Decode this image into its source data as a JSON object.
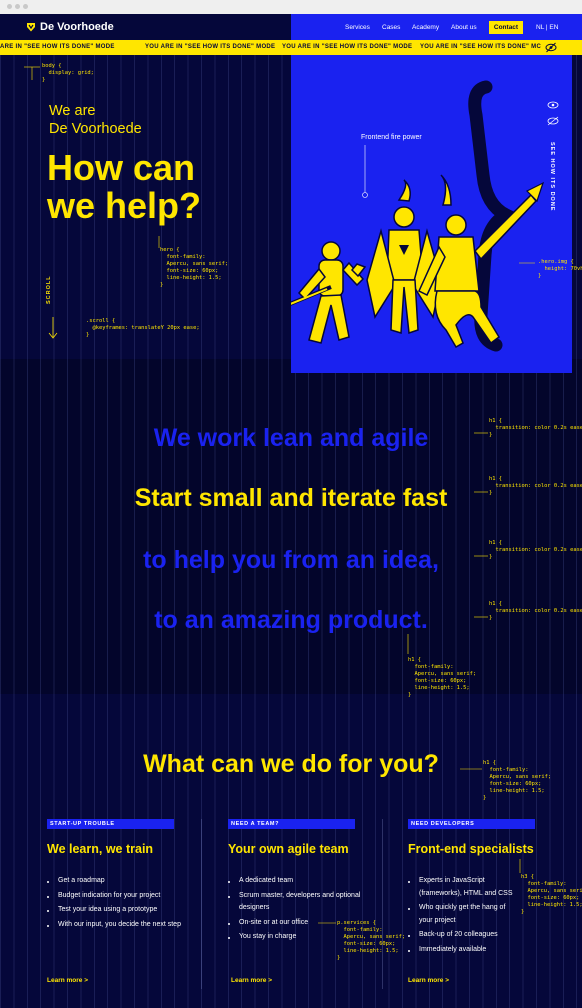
{
  "brand": {
    "name": "De Voorhoede",
    "accent_yellow": "#ffe600",
    "accent_blue": "#1a22f0",
    "background": "#05073a"
  },
  "nav": {
    "links": [
      "Services",
      "Cases",
      "Academy",
      "About us"
    ],
    "contact_label": "Contact",
    "language_label": "NL | EN"
  },
  "marquee": {
    "text": "YOU ARE IN \"SEE HOW ITS DONE\" MODE",
    "first_text": "ARE IN \"SEE HOW ITS DONE\" MODE",
    "last_text": "YOU ARE IN \"SEE HOW ITS DONE\" MC"
  },
  "hero": {
    "subtitle": "We are\nDe Voorhoede",
    "title": "How can\nwe help?",
    "scroll_label": "SCROLL",
    "side_label": "SEE HOW ITS DONE",
    "illustration_caption": "Frontend fire power"
  },
  "code_notes": {
    "body": "body {\n  display: grid;\n}",
    "hero": "hero {\n  font-family:\n  Apercu, sans serif;\n  font-size: 60px;\n  line-height: 1.5;\n}",
    "scroll": ".scroll {\n  @keyframes: translateY 20px ease;\n}",
    "hero_img": ".hero.img {\n  height: 70vh;\n}",
    "h1_transition": "h1 {\n  transition: color 0.2s ease;\n}",
    "h1_font": "h1 {\n  font-family:\n  Apercu, sans serif;\n  font-size: 60px;\n  line-height: 1.5;\n}",
    "services": "p.services {\n  font-family:\n  Apercu, sans serif;\n  font-size: 60px;\n  line-height: 1.5;\n}",
    "h3_font": "h3 {\n  font-family:\n  Apercu, sans serif;\n  font-size: 60px;\n  line-height: 1.5;\n}"
  },
  "statements": [
    {
      "text": "We work lean and agile",
      "color": "#1a22f0"
    },
    {
      "text": "Start small and iterate fast",
      "color": "#ffe600"
    },
    {
      "text": "to help you from an idea,",
      "color": "#1a22f0"
    },
    {
      "text": "to an amazing product.",
      "color": "#1a22f0"
    }
  ],
  "services": {
    "title": "What can we do for you?",
    "cards": [
      {
        "tag": "START-UP TROUBLE",
        "title": "We learn, we train",
        "items": [
          "Get a roadmap",
          "Budget indication for your project",
          "Test your idea using a prototype",
          "With our input, you decide the next step"
        ],
        "link": "Learn more  >"
      },
      {
        "tag": "NEED A TEAM?",
        "title": "Your own agile team",
        "items": [
          "A dedicated team",
          "Scrum master, developers and optional designers",
          "On-site or at our office",
          "You stay in charge"
        ],
        "link": "Learn more  >"
      },
      {
        "tag": "NEED DEVELOPERS",
        "title": "Front-end specialists",
        "items": [
          "Experts in JavaScript (frameworks), HTML and CSS",
          "Who quickly get the hang of your project",
          "Back-up of 20 colleagues",
          "Immediately available"
        ],
        "link": "Learn more  >"
      }
    ]
  }
}
